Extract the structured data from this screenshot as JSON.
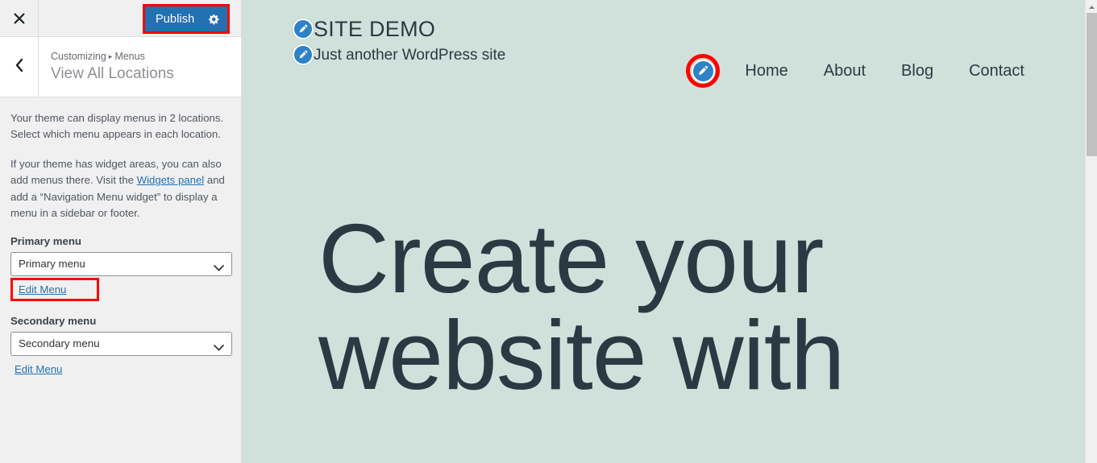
{
  "customizer": {
    "topbar": {
      "close_icon": "close-icon",
      "publish_label": "Publish",
      "publish_gear_icon": "gear-icon",
      "publish_highlight_color": "#ff0000",
      "publish_button_color": "#2271b1"
    },
    "panel_header": {
      "back_icon": "chevron-left-icon",
      "breadcrumb_root": "Customizing",
      "breadcrumb_sep": "▸",
      "breadcrumb_section": "Menus",
      "title": "View All Locations"
    },
    "body": {
      "description_1": "Your theme can display menus in 2 locations. Select which menu appears in each location.",
      "description_2_before": "If your theme has widget areas, you can also add menus there. Visit the ",
      "widgets_panel_link": "Widgets panel",
      "description_2_after": " and add a “Navigation Menu widget” to display a menu in a sidebar or footer.",
      "locations": [
        {
          "label": "Primary menu",
          "selected": "Primary menu",
          "edit_link": "Edit Menu",
          "highlighted": true
        },
        {
          "label": "Secondary menu",
          "selected": "Secondary menu",
          "edit_link": "Edit Menu",
          "highlighted": false
        }
      ]
    }
  },
  "preview": {
    "background_color": "#d0e1dc",
    "text_color": "#2b3a42",
    "site_title": "SITE DEMO",
    "site_tagline": "Just another WordPress site",
    "title_edit_icon": "pencil-edit-icon",
    "tagline_edit_icon": "pencil-edit-icon",
    "nav_edit_icon": "pencil-edit-icon",
    "nav_edit_highlight_color": "#ff0000",
    "nav_items": [
      {
        "label": "Home"
      },
      {
        "label": "About"
      },
      {
        "label": "Blog"
      },
      {
        "label": "Contact"
      }
    ],
    "hero_lines": [
      "Create your",
      "website with"
    ]
  },
  "scrollbar": {
    "up_arrow_icon": "triangle-up-icon",
    "thumb_color": "#c1c1c1"
  }
}
